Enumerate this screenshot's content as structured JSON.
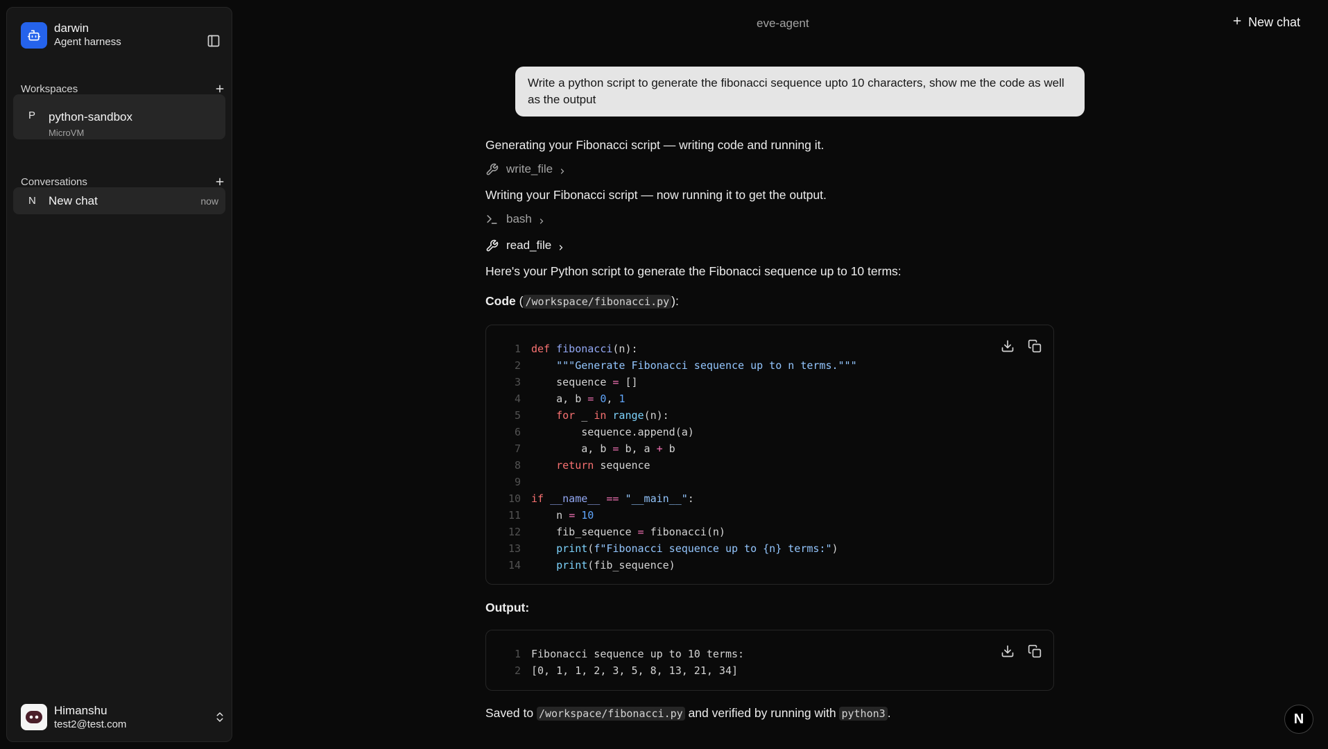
{
  "sidebar": {
    "brand_name": "darwin",
    "brand_sub": "Agent harness",
    "workspaces_label": "Workspaces",
    "workspace": {
      "letter": "P",
      "name": "python-sandbox",
      "type": "MicroVM"
    },
    "conversations_label": "Conversations",
    "conversation": {
      "letter": "N",
      "name": "New chat",
      "time": "now"
    },
    "user": {
      "name": "Himanshu",
      "email": "test2@test.com"
    }
  },
  "header": {
    "title": "eve-agent",
    "new_chat_label": "New chat"
  },
  "chat": {
    "user_message": "Write a python script to generate the fibonacci sequence upto 10 characters, show me the code as well as the output",
    "status1": "Generating your Fibonacci script — writing code and running it.",
    "tool1": "write_file",
    "status2": "Writing your Fibonacci script — now running it to get the output.",
    "tool2": "bash",
    "tool3": "read_file",
    "intro": "Here's your Python script to generate the Fibonacci sequence up to 10 terms:",
    "code_label": "Code",
    "code_path": "/workspace/fibonacci.py",
    "output_label": "Output:",
    "output_lines": [
      "Fibonacci sequence up to 10 terms:",
      "[0, 1, 1, 2, 3, 5, 8, 13, 21, 34]"
    ],
    "saved_prefix": "Saved to",
    "saved_path": "/workspace/fibonacci.py",
    "saved_middle": "and verified by running with",
    "saved_cmd": "python3",
    "saved_suffix": "."
  },
  "badge_letter": "N",
  "colors": {
    "accent": "#2563eb",
    "background": "#0a0a0a",
    "panel": "#171717"
  }
}
